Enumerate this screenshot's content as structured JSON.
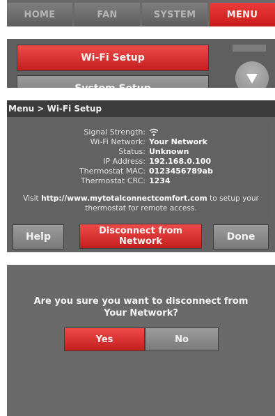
{
  "tabs": [
    {
      "label": "HOME",
      "active": false
    },
    {
      "label": "FAN",
      "active": false
    },
    {
      "label": "SYSTEM",
      "active": false
    },
    {
      "label": "MENU",
      "active": true
    }
  ],
  "menu_list": {
    "items": [
      "Wi-Fi Setup",
      "System Setup"
    ],
    "scroll_icon": "triangle-down-icon"
  },
  "wifi_setup": {
    "breadcrumb": "Menu > Wi-Fi Setup",
    "signal_label": "Signal Strength:",
    "signal_icon": "wifi-signal-icon",
    "network_label": "Wi-Fi Network:",
    "network_value": "Your Network",
    "status_label": "Status:",
    "status_value": "Unknown",
    "ip_label": "IP Address:",
    "ip_value": "192.168.0.100",
    "mac_label": "Thermostat MAC:",
    "mac_value": "0123456789ab",
    "crc_label": "Thermostat CRC:",
    "crc_value": "1234",
    "visit_prefix": "Visit ",
    "visit_url": "http://www.mytotalconnectcomfort.com",
    "visit_suffix": " to setup your thermostat for remote access.",
    "help_label": "Help",
    "disconnect_line1": "Disconnect from",
    "disconnect_line2": "Network",
    "done_label": "Done"
  },
  "confirm": {
    "line1": "Are you sure you want to disconnect from",
    "line2": "Your Network?",
    "yes_label": "Yes",
    "no_label": "No"
  },
  "colors": {
    "accent_red": "#d42a2a",
    "panel_grey": "#666666",
    "header_dark": "#3c3c3c"
  }
}
